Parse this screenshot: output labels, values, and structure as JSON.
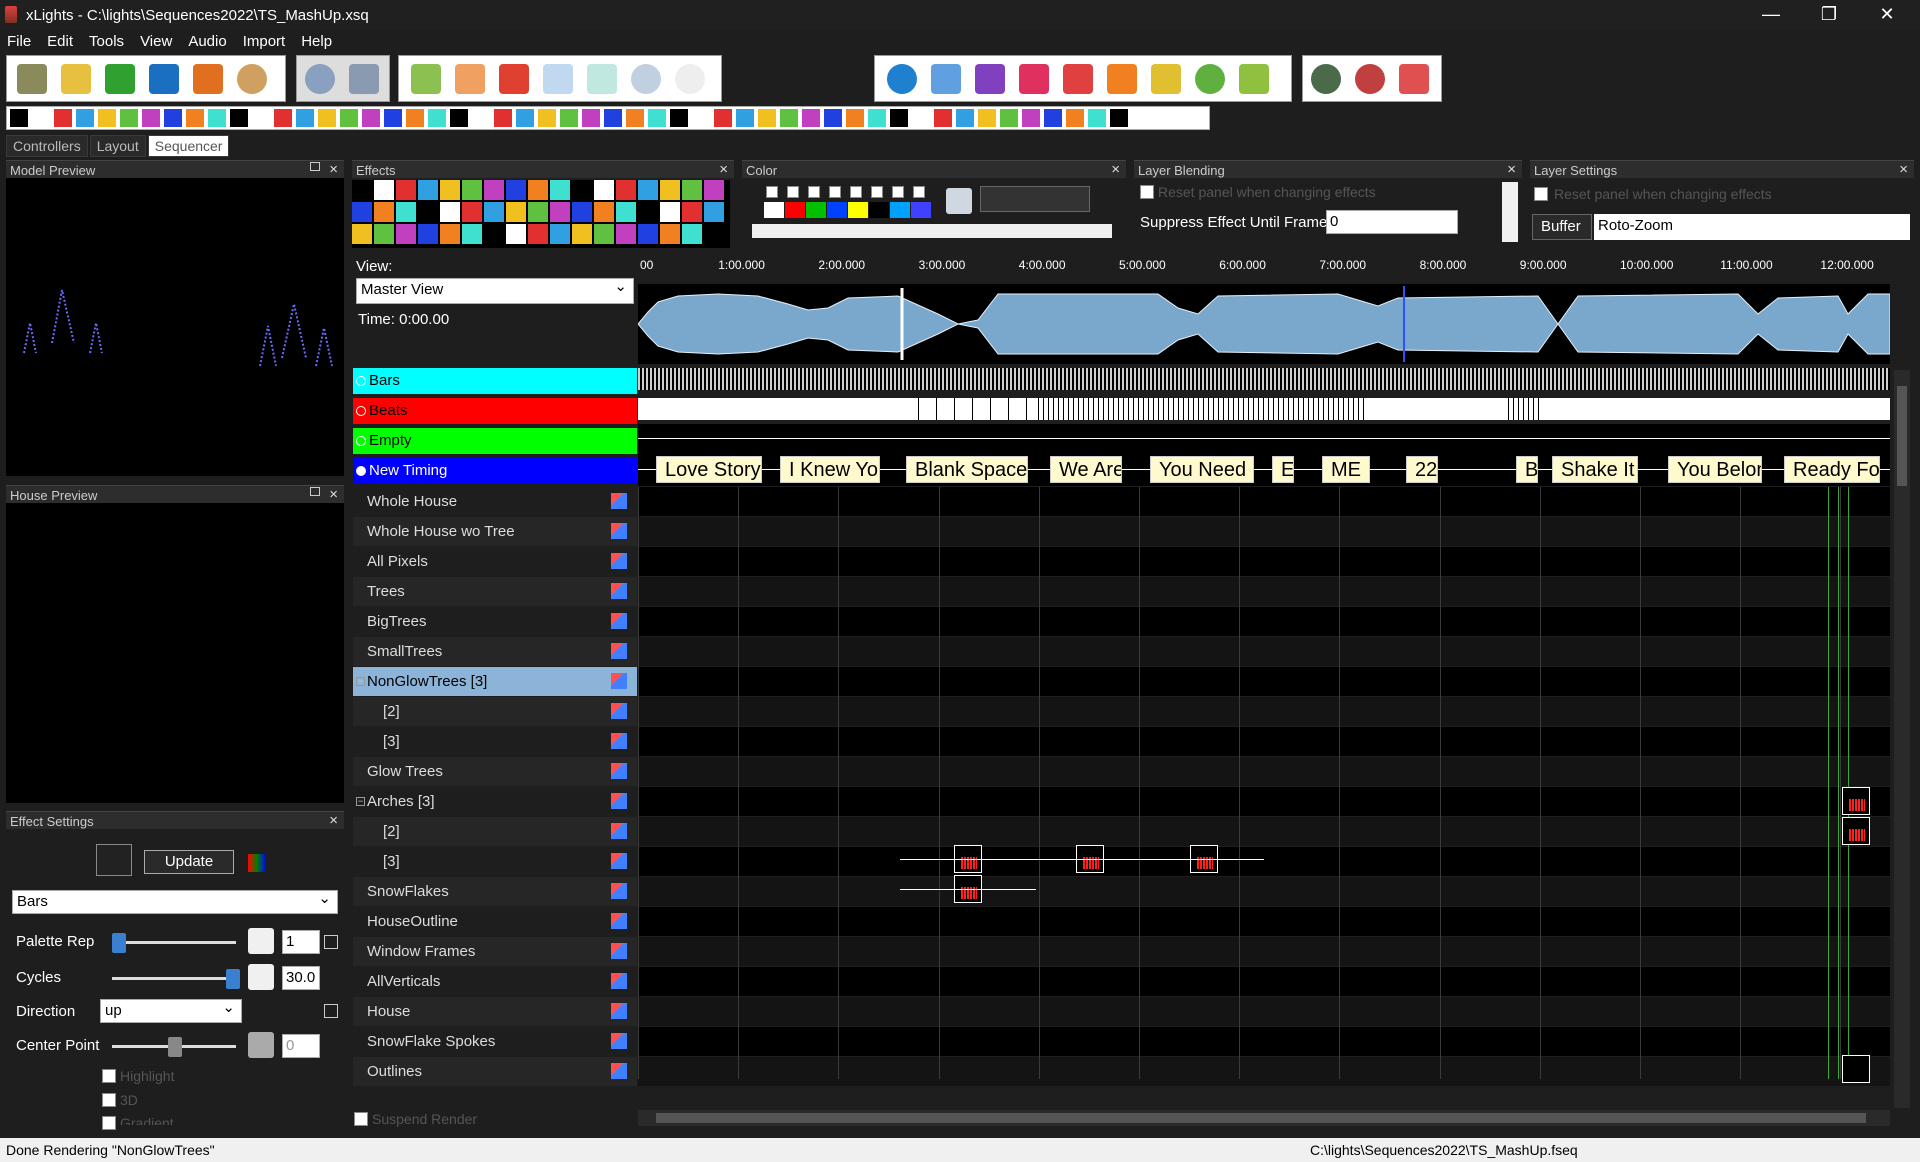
{
  "window": {
    "title": "xLights - C:\\lights\\Sequences2022\\TS_MashUp.xsq",
    "min": "—",
    "max": "❐",
    "close": "✕"
  },
  "menu": [
    "File",
    "Edit",
    "Tools",
    "View",
    "Audio",
    "Import",
    "Help"
  ],
  "tabs": [
    "Controllers",
    "Layout",
    "Sequencer"
  ],
  "panels": {
    "model_preview": "Model Preview",
    "house_preview": "House Preview",
    "effect_settings": "Effect Settings",
    "effects": "Effects",
    "color": "Color",
    "layer_blending": "Layer Blending",
    "layer_settings": "Layer Settings"
  },
  "layer_blending": {
    "reset_label": "Reset panel when changing effects",
    "suppress_label": "Suppress Effect Until Frame",
    "suppress_value": "0"
  },
  "layer_settings": {
    "reset_label": "Reset panel when changing effects",
    "buffer_tab": "Buffer",
    "buffer_value": "Roto-Zoom"
  },
  "view": {
    "label": "View:",
    "value": "Master View",
    "time": "Time: 0:00.00"
  },
  "timeline_ticks": [
    "00",
    "1:00.000",
    "2:00.000",
    "3:00.000",
    "4:00.000",
    "5:00.000",
    "6:00.000",
    "7:00.000",
    "8:00.000",
    "9:00.000",
    "10:00.000",
    "11:00.000",
    "12:00.000"
  ],
  "timing_rows": [
    {
      "name": "Bars",
      "color": "#00ffff"
    },
    {
      "name": "Beats",
      "color": "#ff0000"
    },
    {
      "name": "Empty",
      "color": "#00ff00"
    },
    {
      "name": "New Timing",
      "color": "#0000ff"
    }
  ],
  "songs": [
    "Love Story",
    "I Knew You",
    "Blank Space",
    "We Are",
    "You Need",
    "E",
    "ME",
    "22",
    "B",
    "Shake It",
    "You Belon",
    "Ready Fo"
  ],
  "models": [
    "Whole House",
    "Whole House wo Tree",
    "All Pixels",
    "Trees",
    "BigTrees",
    "SmallTrees",
    "NonGlowTrees [3]",
    "[2]",
    "[3]",
    "Glow Trees",
    "Arches [3]",
    "[2]",
    "[3]",
    "SnowFlakes",
    "HouseOutline",
    "Window Frames",
    "AllVerticals",
    "House",
    "SnowFlake Spokes",
    "Outlines"
  ],
  "effect_settings": {
    "update": "Update",
    "effect": "Bars",
    "palette_rep_label": "Palette Rep",
    "palette_rep_value": "1",
    "cycles_label": "Cycles",
    "cycles_value": "30.0",
    "direction_label": "Direction",
    "direction_value": "up",
    "center_label": "Center Point",
    "center_value": "0",
    "highlight": "Highlight",
    "three_d": "3D",
    "gradient": "Gradient"
  },
  "suspend_render": "Suspend Render",
  "status": {
    "left": "Done Rendering \"NonGlowTrees\"",
    "right": "C:\\lights\\Sequences2022\\TS_MashUp.fseq"
  }
}
